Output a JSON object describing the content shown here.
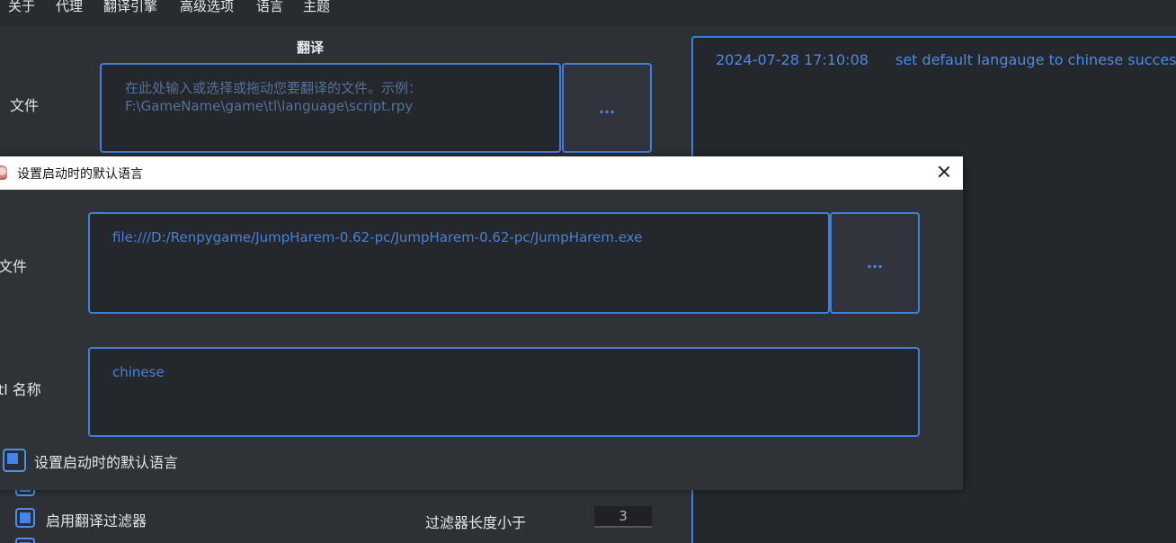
{
  "menu": {
    "items": [
      "关于",
      "代理",
      "翻译引擎",
      "高级选项",
      "语言",
      "主题"
    ]
  },
  "main": {
    "section_title": "翻译",
    "file_label": "文件",
    "file_placeholder": "在此处输入或选择或拖动您要翻译的文件。示例：F:\\GameName\\game\\tl\\language\\script.rpy",
    "browse_label": "...",
    "enable_filter_label": "启用翻译过滤器",
    "filter_length_label": "过滤器长度小于",
    "filter_length_value": "3"
  },
  "log": {
    "entries": [
      {
        "time": "2024-07-28 17:10:08",
        "message": "set default langauge to chinese success!"
      }
    ]
  },
  "dialog": {
    "title": "设置启动时的默认语言",
    "file_label": "文件",
    "file_value": "file:///D:/Renpygame/JumpHarem-0.62-pc/JumpHarem-0.62-pc/JumpHarem.exe",
    "browse_label": "...",
    "tl_label": "tl 名称",
    "tl_value": "chinese",
    "checkbox_label": "设置启动时的默认语言"
  },
  "colors": {
    "accent": "#3f7fdf",
    "text_blue": "#4b8ae6",
    "background": "#2d3035"
  }
}
